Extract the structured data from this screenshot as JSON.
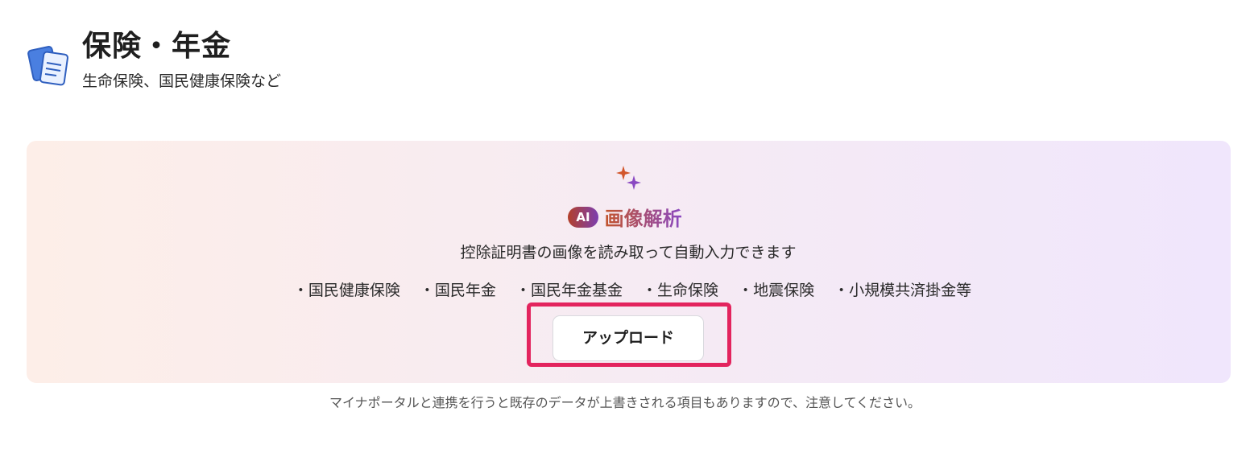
{
  "header": {
    "icon": "document-stack-icon",
    "title": "保険・年金",
    "subtitle": "生命保険、国民健康保険など"
  },
  "ai_panel": {
    "icon": "sparkle-icon",
    "badge": "AI",
    "title": "画像解析",
    "description": "控除証明書の画像を読み取って自動入力できます",
    "categories": [
      "・国民健康保険",
      "・国民年金",
      "・国民年金基金",
      "・生命保険",
      "・地震保険",
      "・小規模共済掛金等"
    ],
    "upload_label": "アップロード"
  },
  "footer": {
    "notice": "マイナポータルと連携を行うと既存のデータが上書きされる項目もありますので、注意してください。"
  },
  "colors": {
    "highlight": "#e3245e",
    "panel_start": "#fdeee8",
    "panel_end": "#f0e6fc",
    "ai_orange": "#c2542d",
    "ai_purple": "#8a49c2"
  }
}
